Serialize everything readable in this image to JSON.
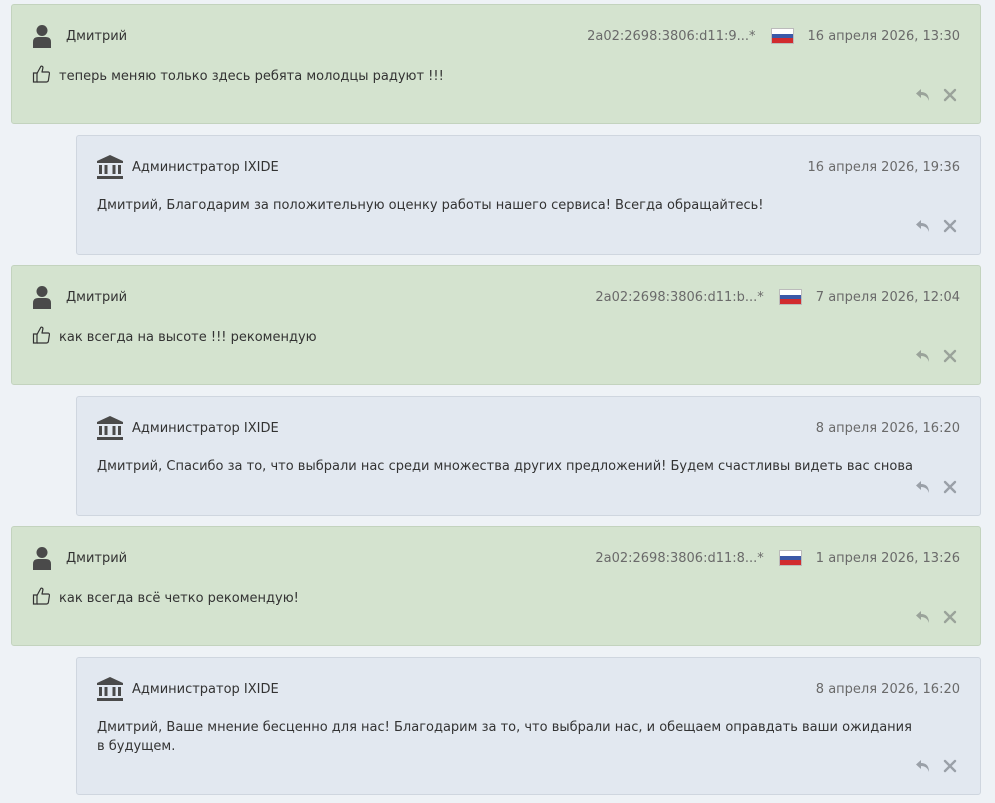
{
  "comments": [
    {
      "author": "Дмитрий",
      "ip": "2a02:2698:3806:d11:9...*",
      "date": "16 апреля 2026, 13:30",
      "text": "теперь меняю только здесь ребята молодцы радуют !!!",
      "reply": {
        "author": "Администратор IXIDE",
        "date": "16 апреля 2026, 19:36",
        "text": "Дмитрий, Благодарим за положительную оценку работы нашего сервиса! Всегда обращайтесь!"
      }
    },
    {
      "author": "Дмитрий",
      "ip": "2a02:2698:3806:d11:b...*",
      "date": "7 апреля 2026, 12:04",
      "text": "как всегда на высоте !!! рекомендую",
      "reply": {
        "author": "Администратор IXIDE",
        "date": "8 апреля 2026, 16:20",
        "text": "Дмитрий, Спасибо за то, что выбрали нас среди множества других предложений! Будем счастливы видеть вас снова"
      }
    },
    {
      "author": "Дмитрий",
      "ip": "2a02:2698:3806:d11:8...*",
      "date": "1 апреля 2026, 13:26",
      "text": "как всегда всё четко рекомендую!",
      "reply": {
        "author": "Администратор IXIDE",
        "date": "8 апреля 2026, 16:20",
        "text": "Дмитрий, Ваше мнение бесценно для нас! Благодарим за то, что выбрали нас, и обещаем оправдать ваши ожидания в будущем."
      }
    }
  ],
  "icons": {
    "avatar": "user-icon",
    "admin": "bank-icon",
    "thumb": "thumbs-up-icon",
    "reply": "reply-icon",
    "delete": "close-icon",
    "flag": "russia-flag-icon"
  },
  "colors": {
    "user_card": "#d4e3cf",
    "admin_card": "#e2e8f0",
    "page_bg": "#eef2f6"
  }
}
